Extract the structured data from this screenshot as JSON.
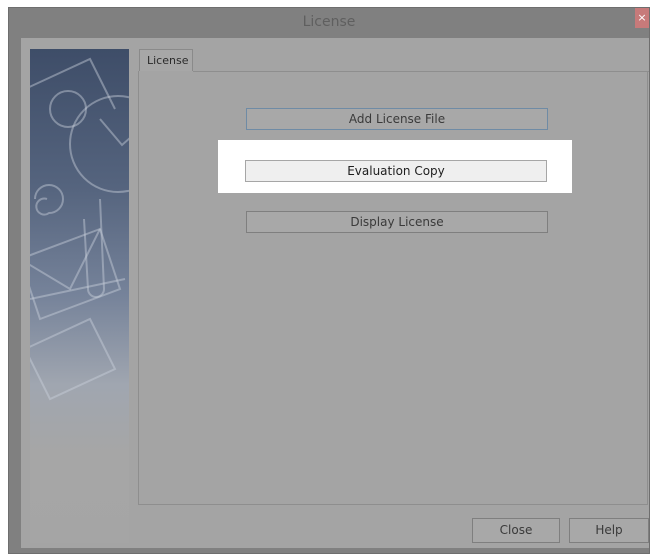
{
  "window": {
    "title": "License",
    "close_glyph": "×"
  },
  "tabs": [
    {
      "label": "License"
    }
  ],
  "buttons": {
    "add_license_file": "Add License File",
    "evaluation_copy": "Evaluation Copy",
    "display_license": "Display License",
    "close": "Close",
    "help": "Help"
  },
  "colors": {
    "dimmed_background": "#a4a4a4",
    "highlight": "#ffffff",
    "close_button": "#c77a7a",
    "sidebar_blue": "#3e4d68"
  }
}
